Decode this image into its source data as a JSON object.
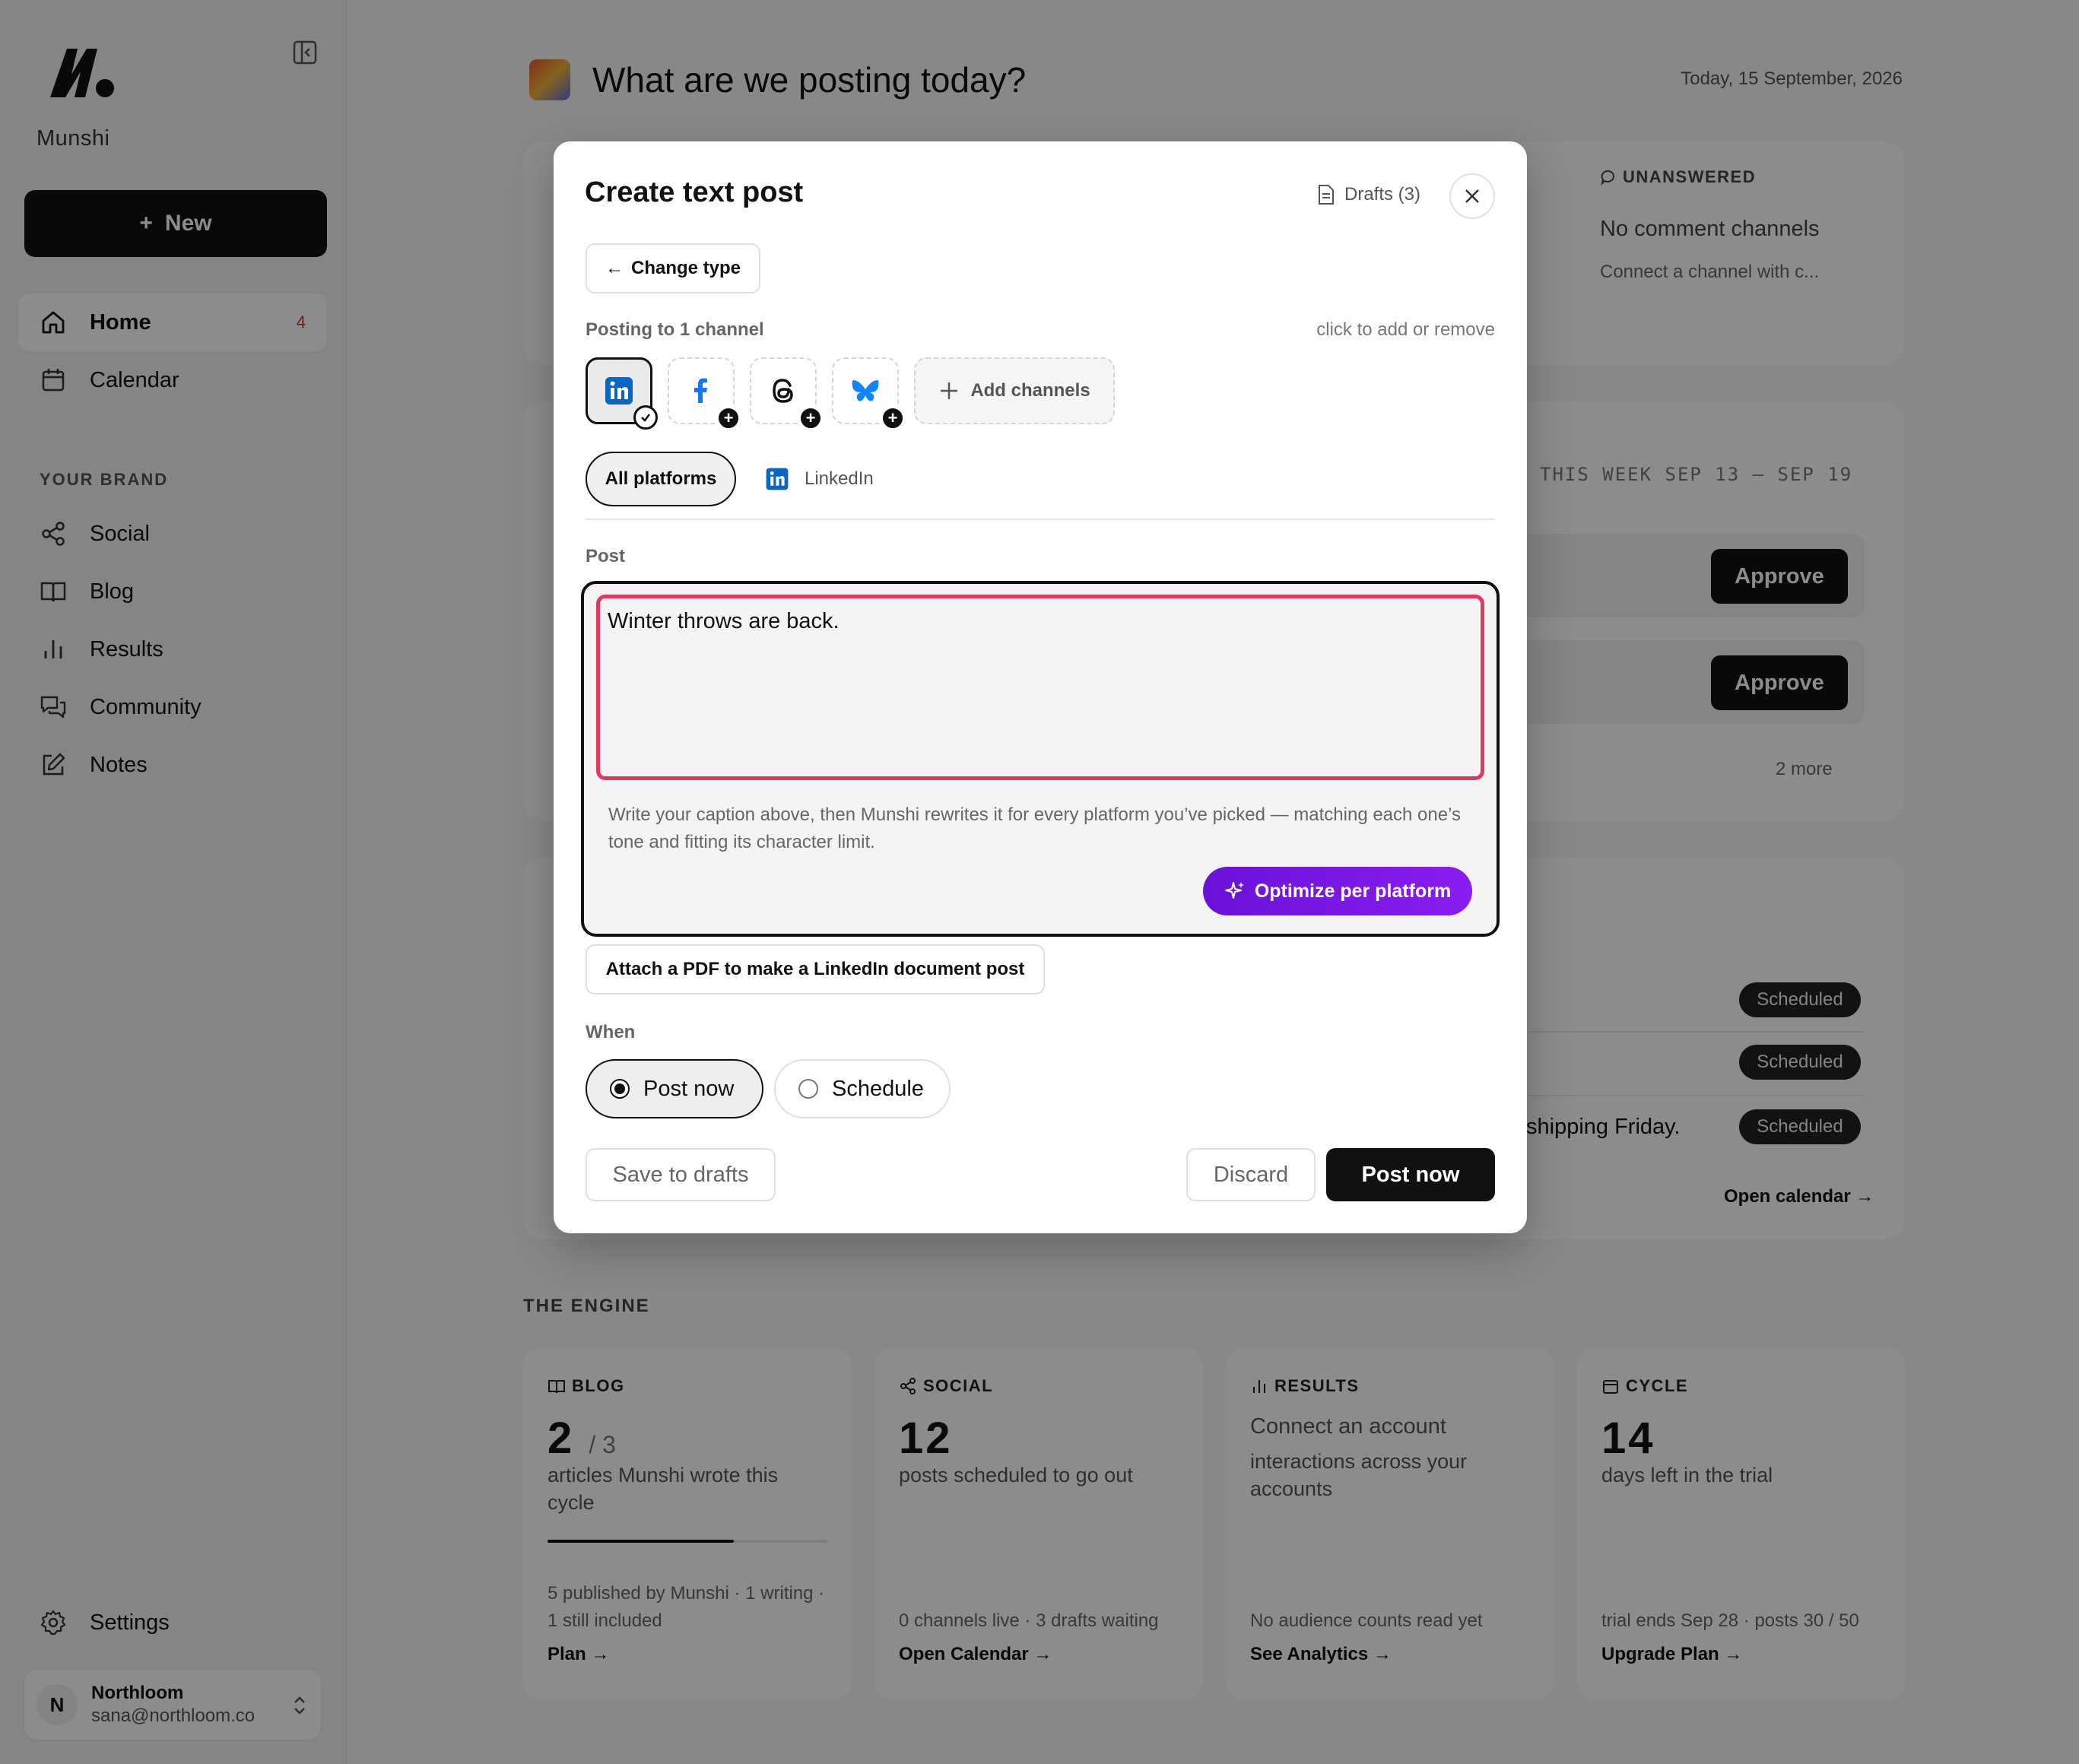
{
  "sidebar": {
    "brand": "Munshi",
    "new_label": "New",
    "nav": [
      {
        "label": "Home",
        "count": "4",
        "icon": "home-icon"
      },
      {
        "label": "Calendar",
        "icon": "calendar-icon"
      }
    ],
    "section_label": "YOUR BRAND",
    "brand_nav": [
      {
        "label": "Social",
        "icon": "share-icon"
      },
      {
        "label": "Blog",
        "icon": "book-icon"
      },
      {
        "label": "Results",
        "icon": "bar-chart-icon"
      },
      {
        "label": "Community",
        "icon": "chat-icon"
      },
      {
        "label": "Notes",
        "icon": "edit-icon"
      }
    ],
    "settings_label": "Settings",
    "account": {
      "initial": "N",
      "name": "Northloom",
      "email": "sana@northloom.co"
    }
  },
  "header": {
    "title": "What are we posting today?",
    "date": "Today, 15 September, 2026"
  },
  "background": {
    "unanswered_label": "UNANSWERED",
    "unanswered_title": "No comment channels",
    "unanswered_sub": "Connect a channel with c...",
    "week_label": "THIS WEEK   SEP 13 – SEP 19",
    "approve_label": "Approve",
    "more_label": "2 more",
    "scheduled_label": "Scheduled",
    "shipping_text": "shipping Friday.",
    "open_calendar": "Open calendar →",
    "engine_label": "THE ENGINE",
    "engine_cards": [
      {
        "head": "BLOG",
        "big": "2",
        "big_suffix": "/ 3",
        "sub": "articles Munshi wrote this cycle",
        "progress": 0.667,
        "foot": "5 published by Munshi · 1 writing · 1 still included",
        "link": "Plan →"
      },
      {
        "head": "SOCIAL",
        "big": "12",
        "sub": "posts scheduled to go out",
        "foot": "0 channels live · 3 drafts waiting",
        "link": "Open Calendar →"
      },
      {
        "head": "RESULTS",
        "title": "Connect an account",
        "sub": "interactions across your accounts",
        "foot": "No audience counts read yet",
        "link": "See Analytics →"
      },
      {
        "head": "CYCLE",
        "big": "14",
        "sub": "days left in the trial",
        "foot": "trial ends Sep 28 · posts 30 / 50",
        "link": "Upgrade Plan →"
      }
    ]
  },
  "modal": {
    "title": "Create text post",
    "drafts_label": "Drafts (3)",
    "change_type_label": "Change type",
    "posting_to": "Posting to 1 channel",
    "click_hint": "click to add or remove",
    "channels": [
      {
        "name": "LinkedIn",
        "icon": "linkedin-icon",
        "selected": true
      },
      {
        "name": "Facebook",
        "icon": "facebook-icon",
        "selected": false
      },
      {
        "name": "Threads",
        "icon": "threads-icon",
        "selected": false
      },
      {
        "name": "Bluesky",
        "icon": "bluesky-icon",
        "selected": false
      }
    ],
    "add_channels_label": "Add channels",
    "tabs": {
      "all": "All platforms",
      "linkedin": "LinkedIn"
    },
    "post_label": "Post",
    "post_value": "Winter throws are back.",
    "helper_text": "Write your caption above, then Munshi rewrites it for every platform you’ve picked — matching each one’s tone and fitting its character limit.",
    "optimize_label": "Optimize per platform",
    "attach_label": "Attach a PDF to make a LinkedIn document post",
    "when_label": "When",
    "when_options": {
      "now": "Post now",
      "schedule": "Schedule",
      "selected": "now"
    },
    "save_drafts_label": "Save to drafts",
    "discard_label": "Discard",
    "post_now_label": "Post now"
  },
  "colors": {
    "accent_purple": "#7a17e6",
    "input_border": "#e2385f",
    "linkedin": "#0a66c2",
    "facebook": "#1877f2",
    "bluesky": "#1185fe"
  }
}
